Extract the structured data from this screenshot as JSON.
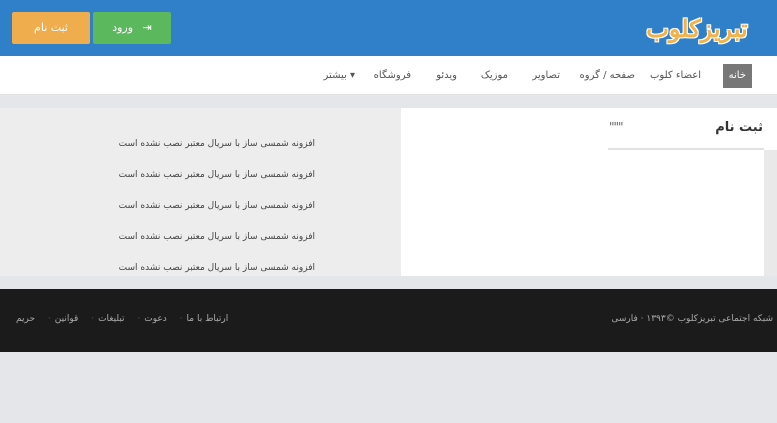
{
  "header": {
    "logo_text": "تبریزکلوب",
    "login_label": "ورود",
    "register_label": "ثبت نام"
  },
  "nav": {
    "items": [
      {
        "label": "خانه",
        "active": true
      },
      {
        "label": "اعضاء کلوب"
      },
      {
        "label": "صفحه / گروه"
      },
      {
        "label": "تصاویر"
      },
      {
        "label": "موزیک"
      },
      {
        "label": "ویدئو"
      },
      {
        "label": "فروشگاه"
      },
      {
        "label": "بیشتر ▾"
      }
    ]
  },
  "panel": {
    "title": "ثبت نام",
    "menu": "\"\"\""
  },
  "messages": [
    "افزونه شمسی ساز با سریال معتبر نصب نشده است",
    "افزونه شمسی ساز با سریال معتبر نصب نشده است",
    "افزونه شمسی ساز با سریال معتبر نصب نشده است",
    "افزونه شمسی ساز با سریال معتبر نصب نشده است",
    "افزونه شمسی ساز با سریال معتبر نصب نشده است"
  ],
  "footer": {
    "copyright": "شبکه اجتماعی تبریزکلوب ©۱۳۹۳ · فارسی",
    "links": [
      "حریم",
      "قوانین",
      "تبلیغات",
      "دعوت",
      "ارتباط با ما"
    ]
  }
}
